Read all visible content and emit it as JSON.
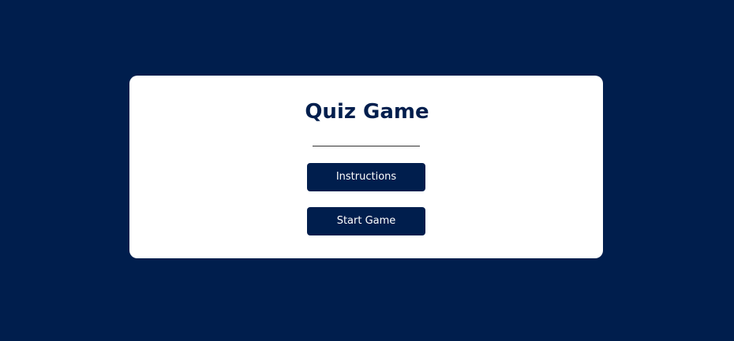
{
  "app": {
    "title": "Quiz Game"
  },
  "menu": {
    "instructions_label": "Instructions",
    "start_label": "Start Game"
  },
  "colors": {
    "background": "#001e4d",
    "card": "#ffffff",
    "button": "#001e4d",
    "button_text": "#ffffff"
  }
}
